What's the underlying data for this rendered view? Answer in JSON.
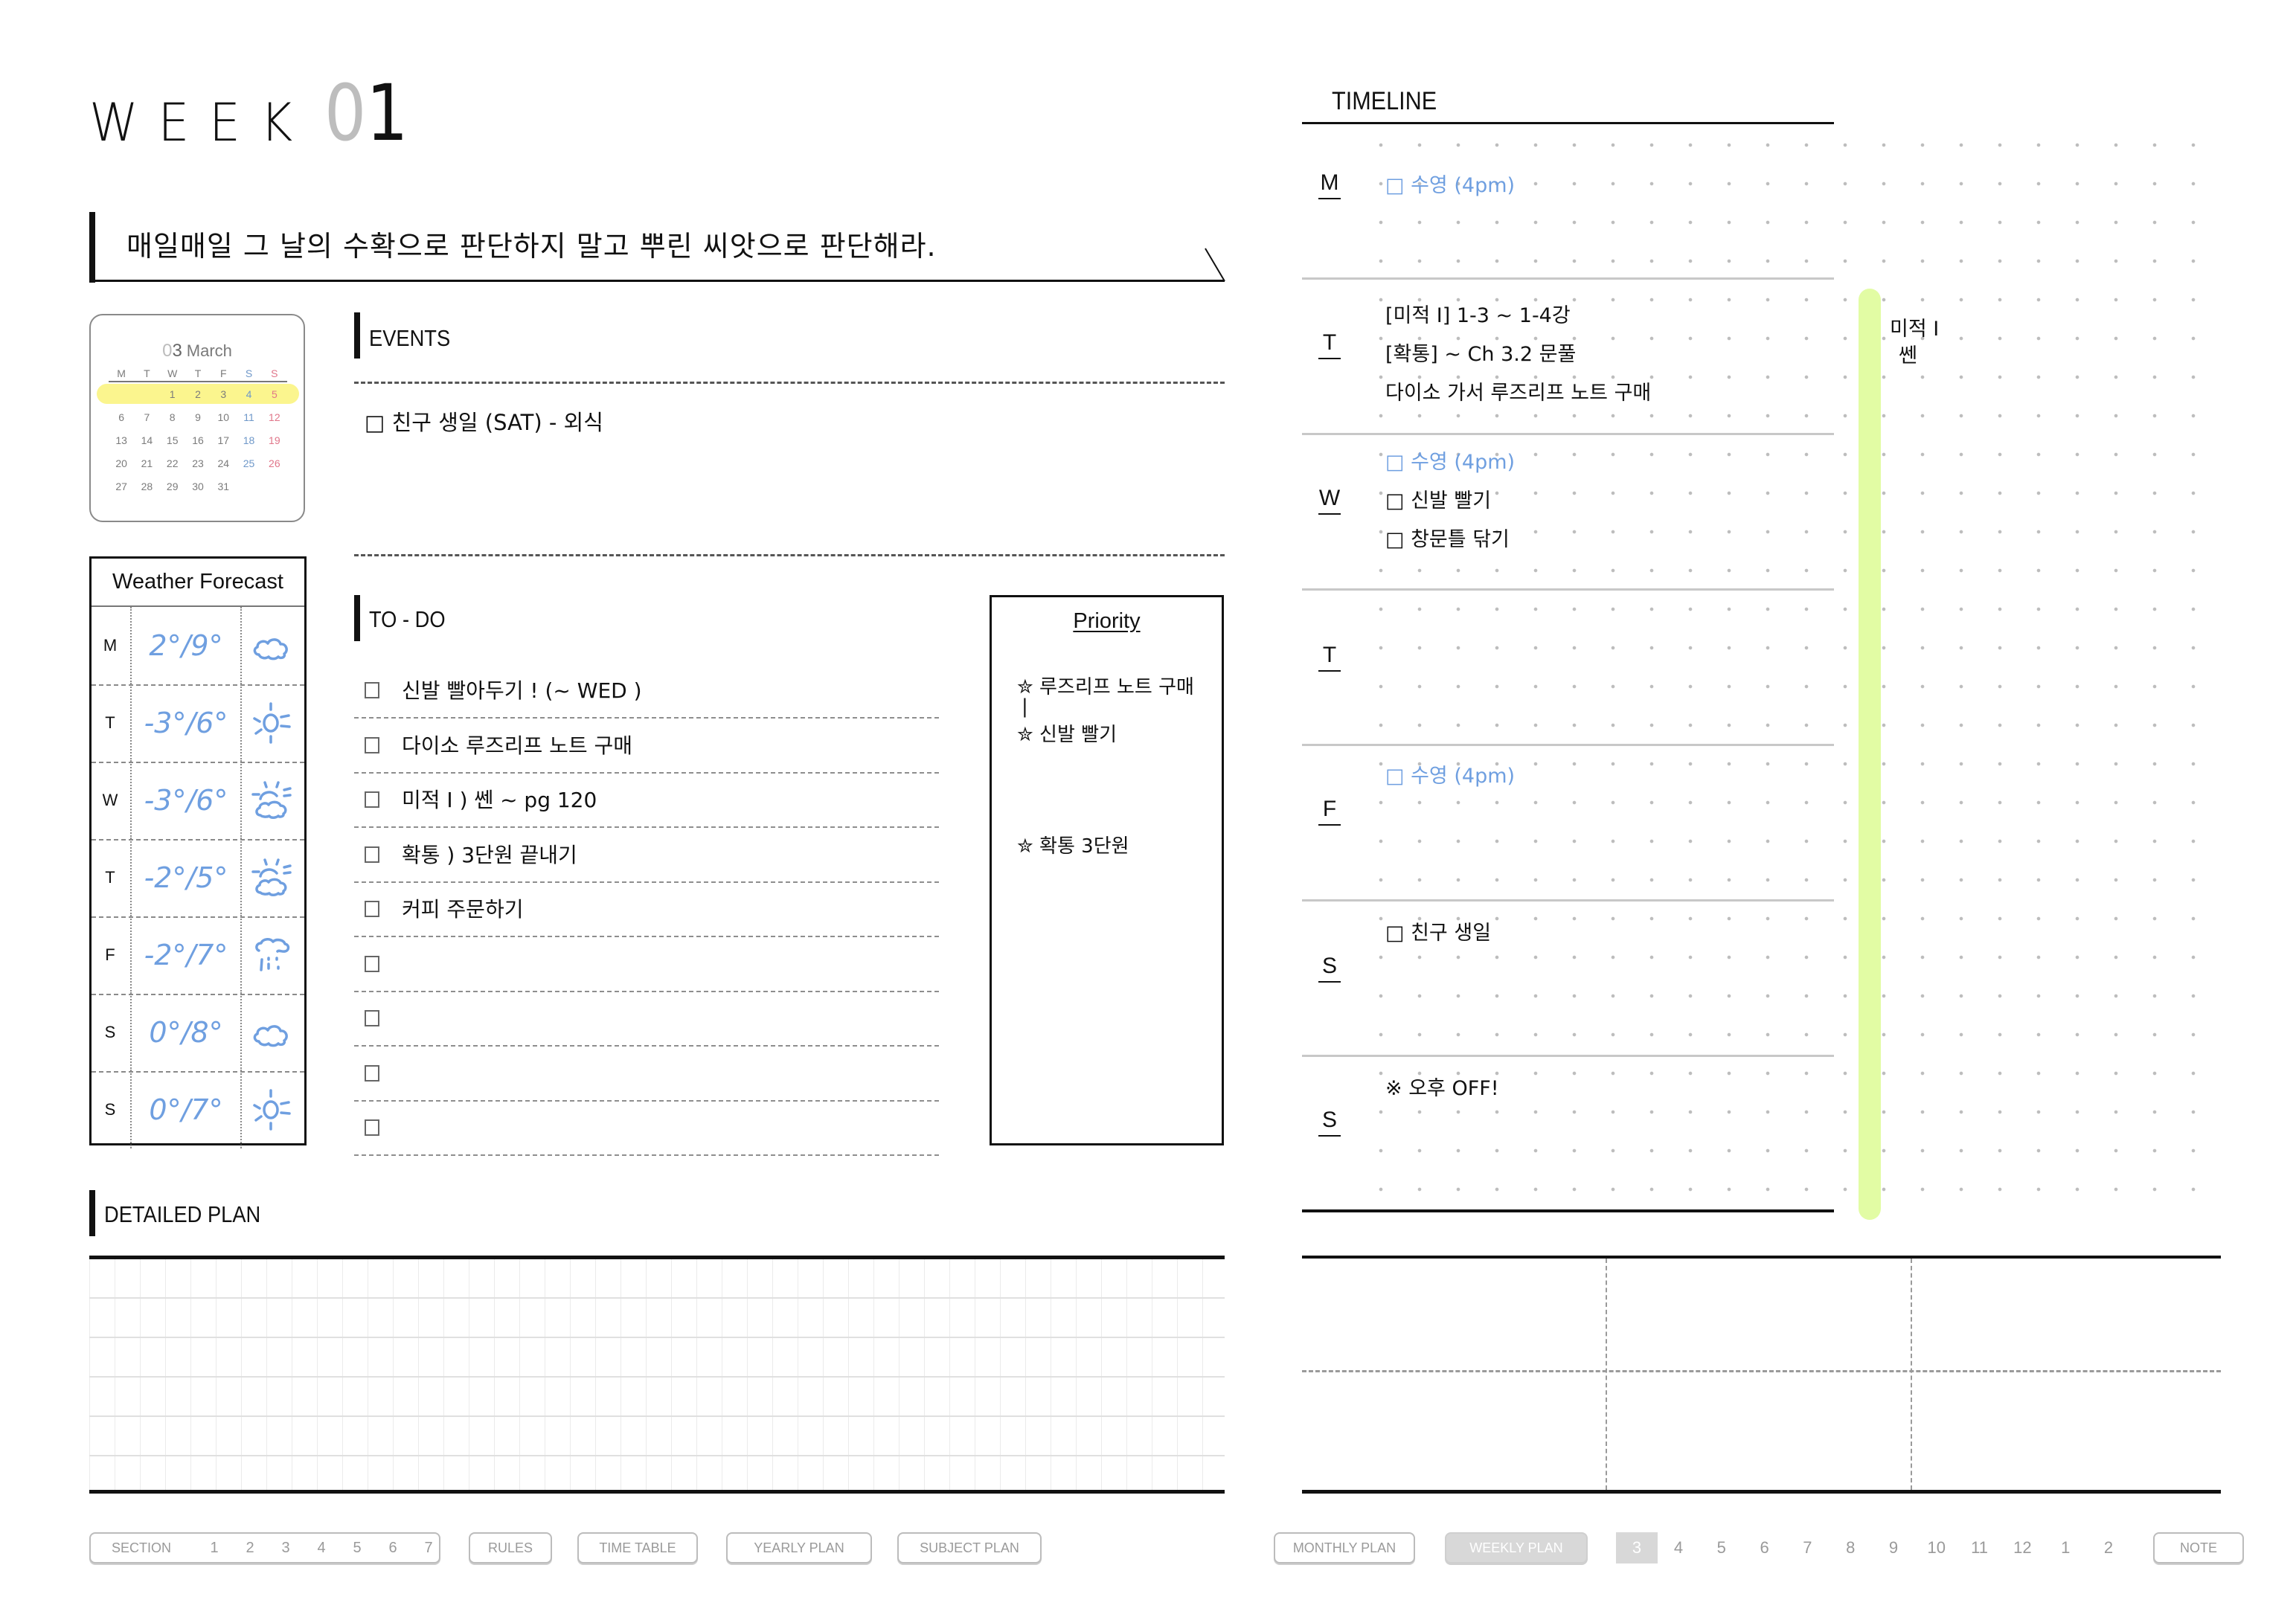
{
  "header": {
    "week_word": "WEEK",
    "week_number_first_digit": "0",
    "week_number_second_digit": "1",
    "quote": "매일매일 그 날의 수확으로 판단하지 말고 뿌린 씨앗으로 판단해라."
  },
  "calendar": {
    "month_number_first_digit": "0",
    "month_number_second_digit": "3",
    "month_name": "March",
    "weekday_headers": [
      "M",
      "T",
      "W",
      "T",
      "F",
      "S",
      "S"
    ],
    "highlight_color": "#fbf58e",
    "highlighted_week_index": 0,
    "weeks": [
      [
        "",
        "",
        "1",
        "2",
        "3",
        "4",
        "5"
      ],
      [
        "6",
        "7",
        "8",
        "9",
        "10",
        "11",
        "12"
      ],
      [
        "13",
        "14",
        "15",
        "16",
        "17",
        "18",
        "19"
      ],
      [
        "20",
        "21",
        "22",
        "23",
        "24",
        "25",
        "26"
      ],
      [
        "27",
        "28",
        "29",
        "30",
        "31",
        "",
        ""
      ]
    ]
  },
  "weather": {
    "title": "Weather  Forecast",
    "rows": [
      {
        "day": "M",
        "temp": "2°/9°",
        "icon": "cloud-icon"
      },
      {
        "day": "T",
        "temp": "-3°/6°",
        "icon": "sun-icon"
      },
      {
        "day": "W",
        "temp": "-3°/6°",
        "icon": "partly-cloudy-icon"
      },
      {
        "day": "T",
        "temp": "-2°/5°",
        "icon": "partly-cloudy-icon"
      },
      {
        "day": "F",
        "temp": "-2°/7°",
        "icon": "rain-icon"
      },
      {
        "day": "S",
        "temp": "0°/8°",
        "icon": "cloud-icon"
      },
      {
        "day": "S",
        "temp": "0°/7°",
        "icon": "sun-icon"
      }
    ]
  },
  "events": {
    "label": "EVENTS",
    "items": [
      "□ 친구 생일 (SAT) - 외식"
    ]
  },
  "todo": {
    "label": "TO - DO",
    "items": [
      {
        "text": "신발 빨아두기 ! (~ WED )",
        "checked": false
      },
      {
        "text": "다이소 루즈리프 노트 구매",
        "checked": false
      },
      {
        "text": "미적 I ) 쎈 ~ pg 120",
        "checked": false
      },
      {
        "text": "확통 ) 3단원 끝내기",
        "checked": false
      },
      {
        "text": "커피 주문하기",
        "checked": false
      },
      {
        "text": "",
        "checked": false
      },
      {
        "text": "",
        "checked": false
      },
      {
        "text": "",
        "checked": false
      },
      {
        "text": "",
        "checked": false
      }
    ]
  },
  "priority": {
    "title": "Priority",
    "items": [
      "✮ 루즈리프 노트 구매",
      "|",
      "✮ 신발 빨기",
      "✮ 확통 3단원"
    ]
  },
  "detailed_plan": {
    "label": "DETAILED PLAN"
  },
  "timeline": {
    "title": "TIMELINE",
    "highlight_color": "#e2fca4",
    "side_note": [
      "미적 I",
      "쎈"
    ],
    "days": [
      {
        "day": "M",
        "notes": [
          {
            "text": "□ 수영 (4pm)",
            "color": "blue"
          }
        ]
      },
      {
        "day": "T",
        "notes": [
          {
            "text": "[미적 I] 1-3 ~ 1-4강",
            "color": "black"
          },
          {
            "text": "[확통] ~ Ch 3.2 문풀",
            "color": "black"
          },
          {
            "text": "다이소 가서 루즈리프 노트 구매",
            "color": "black"
          }
        ]
      },
      {
        "day": "W",
        "notes": [
          {
            "text": "□ 수영 (4pm)",
            "color": "blue"
          },
          {
            "text": "□ 신발 빨기",
            "color": "black"
          },
          {
            "text": "□ 창문틀 닦기",
            "color": "black"
          }
        ]
      },
      {
        "day": "T",
        "notes": []
      },
      {
        "day": "F",
        "notes": [
          {
            "text": "□ 수영 (4pm)",
            "color": "blue"
          }
        ]
      },
      {
        "day": "S",
        "notes": [
          {
            "text": "□ 친구 생일",
            "color": "black"
          }
        ]
      },
      {
        "day": "S",
        "notes": [
          {
            "text": "※ 오후 OFF!",
            "color": "black"
          }
        ]
      }
    ]
  },
  "footer": {
    "section_label": "SECTION",
    "section_numbers": [
      "1",
      "2",
      "3",
      "4",
      "5",
      "6",
      "7"
    ],
    "left_buttons": [
      "RULES",
      "TIME TABLE",
      "YEARLY PLAN",
      "SUBJECT PLAN"
    ],
    "monthly_plan": "MONTHLY PLAN",
    "weekly_plan": "WEEKLY PLAN",
    "month_tabs": [
      "3",
      "4",
      "5",
      "6",
      "7",
      "8",
      "9",
      "10",
      "11",
      "12",
      "1",
      "2"
    ],
    "active_month": "3",
    "note": "NOTE"
  },
  "colors": {
    "handwriting_blue": "#6f9fe0",
    "saturday": "#6f98c9",
    "sunday": "#e0768a",
    "footer_active": "#d8d8d8"
  }
}
